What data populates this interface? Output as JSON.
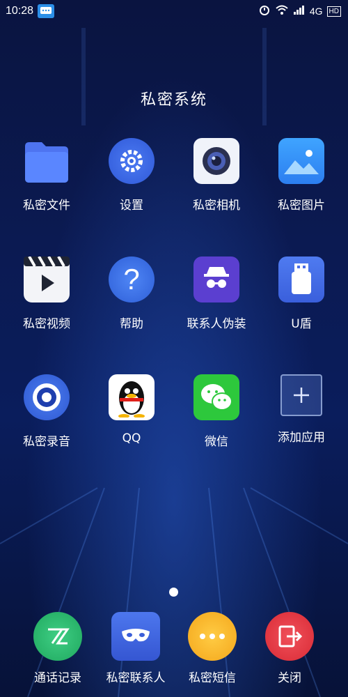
{
  "status_bar": {
    "time": "10:28",
    "network": "4G",
    "hd_badge": "HD"
  },
  "folder_title": "私密系统",
  "apps": [
    {
      "label": "私密文件",
      "icon": "folder-icon"
    },
    {
      "label": "设置",
      "icon": "gear-icon"
    },
    {
      "label": "私密相机",
      "icon": "camera-icon"
    },
    {
      "label": "私密图片",
      "icon": "picture-icon"
    },
    {
      "label": "私密视频",
      "icon": "video-clapper-icon"
    },
    {
      "label": "帮助",
      "icon": "question-icon"
    },
    {
      "label": "联系人伪装",
      "icon": "spy-mask-icon"
    },
    {
      "label": "U盾",
      "icon": "usb-shield-icon"
    },
    {
      "label": "私密录音",
      "icon": "recorder-icon"
    },
    {
      "label": "QQ",
      "icon": "qq-penguin-icon"
    },
    {
      "label": "微信",
      "icon": "wechat-icon"
    },
    {
      "label": "添加应用",
      "icon": "plus-icon"
    }
  ],
  "dock": [
    {
      "label": "通话记录",
      "icon": "call-log-icon"
    },
    {
      "label": "私密联系人",
      "icon": "contact-mask-icon"
    },
    {
      "label": "私密短信",
      "icon": "message-dots-icon"
    },
    {
      "label": "关闭",
      "icon": "exit-icon"
    }
  ]
}
